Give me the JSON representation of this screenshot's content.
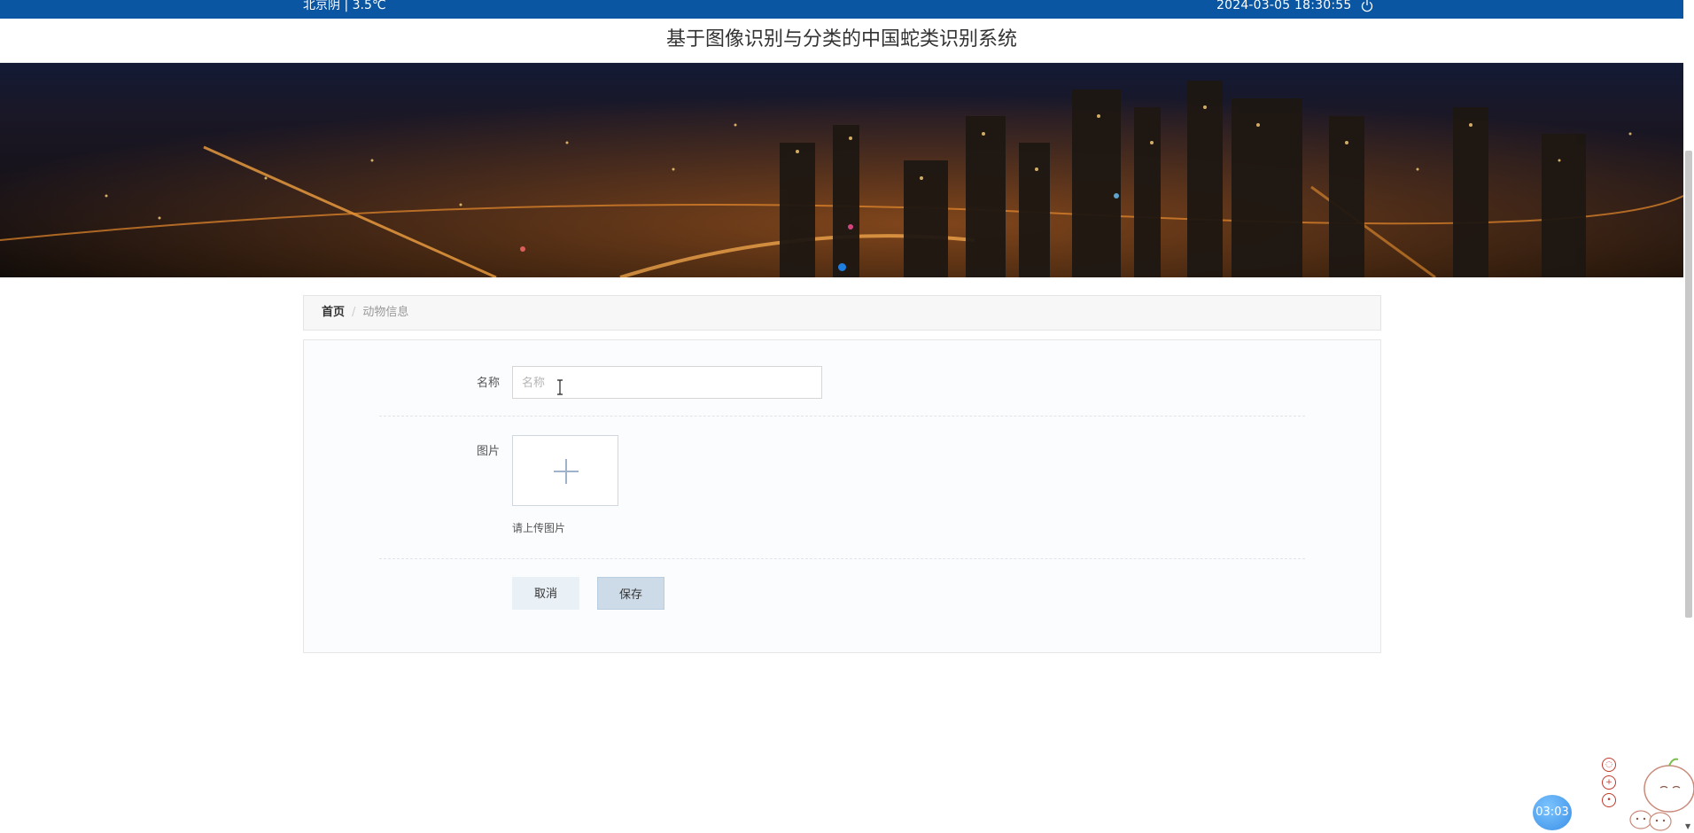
{
  "topbar": {
    "weather": "北京阴 | 3.5℃",
    "datetime": "2024-03-05   18:30:55",
    "power_icon": "power-icon"
  },
  "header": {
    "title": "基于图像识别与分类的中国蛇类识别系统"
  },
  "breadcrumb": {
    "home": "首页",
    "separator": "/",
    "current": "动物信息"
  },
  "form": {
    "name_label": "名称",
    "name_placeholder": "名称",
    "name_value": "",
    "image_label": "图片",
    "upload_hint": "请上传图片",
    "cancel_label": "取消",
    "save_label": "保存"
  },
  "widgets": {
    "timer": "03:03"
  },
  "colors": {
    "topbar": "#0a56a3",
    "carousel_dot": "#1e7fe0",
    "save_button": "#cddbe8"
  }
}
